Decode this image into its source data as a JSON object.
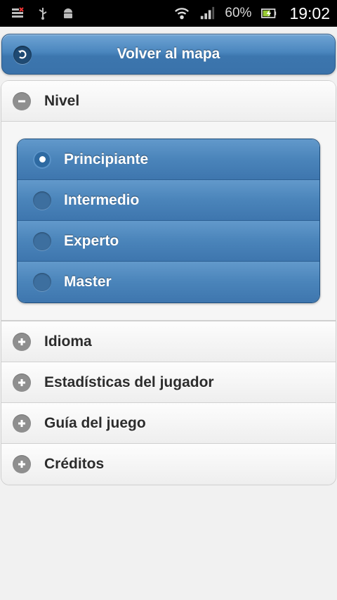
{
  "status_bar": {
    "icons_left": [
      "notification-icon",
      "usb-icon",
      "android-debug-icon"
    ],
    "icons_right": [
      "wifi-icon",
      "signal-icon",
      "battery-charging-icon"
    ],
    "battery": "60%",
    "time": "19:02"
  },
  "header": {
    "back_label": "Volver al mapa"
  },
  "sections": {
    "nivel": {
      "label": "Nivel",
      "expanded": true,
      "options": [
        {
          "label": "Principiante",
          "selected": true
        },
        {
          "label": "Intermedio",
          "selected": false
        },
        {
          "label": "Experto",
          "selected": false
        },
        {
          "label": "Master",
          "selected": false
        }
      ]
    },
    "collapsed": [
      {
        "label": "Idioma"
      },
      {
        "label": "Estadísticas del jugador"
      },
      {
        "label": "Guía del juego"
      },
      {
        "label": "Créditos"
      }
    ]
  },
  "colors": {
    "accent_blue": "#4a84ba",
    "icon_gray": "#8f8f8f",
    "background": "#f1f1f1"
  }
}
